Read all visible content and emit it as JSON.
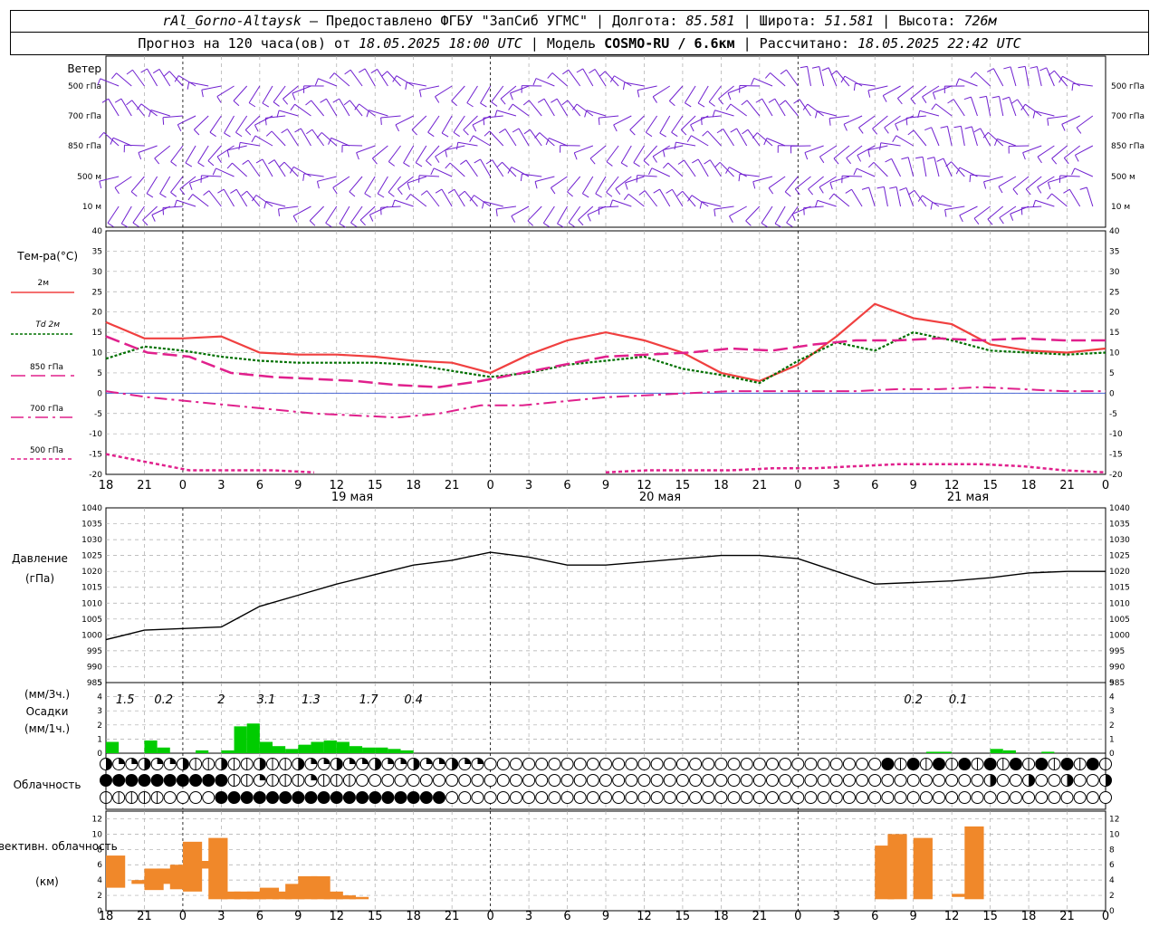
{
  "header": {
    "station": "rAl_Gorno-Altaysk",
    "provider": "— Предоставлено ФГБУ \"ЗапСиб УГМС\"",
    "lon_label": "Долгота:",
    "lon": "85.581",
    "lat_label": "Широта:",
    "lat": "51.581",
    "alt_label": "Высота:",
    "alt": "726м",
    "forecast_prefix": "Прогноз на 120 часа(ов) от",
    "forecast_time": "18.05.2025 18:00 UTC",
    "model_label": "| Модель",
    "model": "COSMO-RU / 6.6км",
    "calc_label": "| Рассчитано:",
    "calc_time": "18.05.2025 22:42 UTC"
  },
  "panels": {
    "wind": {
      "title": "Ветер",
      "levels": [
        "500 гПа",
        "700 гПа",
        "850 гПа",
        "500 м",
        "10 м"
      ]
    },
    "temp": {
      "title": "Тем-ра(°C)",
      "legend": [
        "2м",
        "Td 2м",
        "850 гПа",
        "700 гПа",
        "500 гПа"
      ]
    },
    "pressure": {
      "title": "Давление",
      "unit": "(гПа)"
    },
    "precip": {
      "title": "Осадки",
      "unit_top": "(мм/3ч.)",
      "unit_bottom": "(мм/1ч.)"
    },
    "cloud": {
      "title": "Облачность"
    },
    "conv": {
      "title": "Конвективн. облачность",
      "unit": "(км)"
    }
  },
  "time_axis": {
    "hours": [
      "18",
      "21",
      "0",
      "3",
      "6",
      "9",
      "12",
      "15",
      "18",
      "21",
      "0",
      "3",
      "6",
      "9",
      "12",
      "15",
      "18",
      "21",
      "0",
      "3",
      "6",
      "9",
      "12",
      "15",
      "18",
      "21",
      "0"
    ],
    "days": [
      "19 мая",
      "20 мая",
      "21 мая"
    ]
  },
  "colors": {
    "t2m": "#f04040",
    "td": "#007000",
    "p850": "#e0208c",
    "wind": "#7020d0",
    "precip": "#00cc00",
    "conv": "#f0882a"
  },
  "chart_data": [
    {
      "type": "line",
      "title": "Тем-ра(°C)",
      "x_hours_from_start": [
        0,
        3,
        6,
        9,
        12,
        15,
        18,
        21,
        24,
        27,
        30,
        33,
        36,
        39,
        42,
        45,
        48,
        51,
        54,
        57,
        60,
        63,
        66,
        69,
        72,
        75,
        78
      ],
      "ylim": [
        -20,
        40
      ],
      "series": [
        {
          "name": "2м",
          "values": [
            17.5,
            13.5,
            13.5,
            14,
            10,
            9.5,
            9.5,
            9,
            8,
            7.5,
            5,
            9.5,
            13,
            15,
            13,
            10,
            5,
            3,
            7,
            14,
            22,
            18.5,
            17,
            12,
            10.5,
            10,
            11
          ]
        },
        {
          "name": "Td 2м",
          "values": [
            8.5,
            11.5,
            10.5,
            9,
            8,
            7.5,
            7.5,
            7.5,
            7,
            5.5,
            4,
            5,
            7,
            8,
            9,
            6,
            4.5,
            2.5,
            8,
            12.5,
            10.5,
            15,
            13,
            10.5,
            10,
            9.5,
            10
          ]
        },
        {
          "name": "850 гПа",
          "values": [
            14,
            10,
            9,
            5,
            4,
            3.5,
            3,
            2,
            1.5,
            3,
            5,
            7,
            9,
            9.5,
            10,
            11,
            10.5,
            12,
            13,
            13,
            13.5,
            13,
            13.5,
            13,
            13
          ]
        },
        {
          "name": "700 гПа",
          "values": [
            0.5,
            -1,
            -2,
            -3,
            -4,
            -5,
            -5.5,
            -6,
            -5,
            -3,
            -3,
            -2,
            -1,
            -0.5,
            0,
            0.5,
            0.5,
            0.5,
            0.5,
            1,
            1,
            1.5,
            1,
            0.5,
            0.5
          ]
        },
        {
          "name": "500 гПа",
          "values": [
            -15,
            -17,
            -19,
            -19,
            -19,
            -19.5,
            null,
            null,
            null,
            null,
            null,
            null,
            -19.5,
            -19,
            -19,
            -19,
            -18.5,
            -18.5,
            -18,
            -17.5,
            -17.5,
            -17.5,
            -18,
            -19,
            -19.5
          ]
        }
      ]
    },
    {
      "type": "line",
      "title": "Давление",
      "ylabel": "(гПа)",
      "ylim": [
        985,
        1040
      ],
      "x_hours_from_start": [
        0,
        3,
        6,
        9,
        12,
        15,
        18,
        21,
        24,
        27,
        30,
        33,
        36,
        39,
        42,
        45,
        48,
        51,
        54,
        57,
        60,
        63,
        66,
        69,
        72,
        75,
        78
      ],
      "values": [
        998.5,
        1001.5,
        1002,
        1002.5,
        1009,
        1012.5,
        1016,
        1019,
        1022,
        1023.5,
        1026,
        1024.5,
        1022,
        1022,
        1023,
        1024,
        1025,
        1025,
        1024,
        1020,
        1016,
        1016.5,
        1017,
        1018,
        1019.5,
        1020,
        1020
      ]
    },
    {
      "type": "bar",
      "title": "Осадки",
      "ylim": [
        0,
        5
      ],
      "labels_3h": [
        "1.5",
        "0.2",
        "2",
        "3.1",
        "1.3",
        "1.7",
        "0.4",
        "0.2",
        "0.1"
      ],
      "hourly": [
        0.8,
        0,
        0,
        0.9,
        0.4,
        0,
        0,
        0.2,
        0,
        0.2,
        1.9,
        2.1,
        0.8,
        0.5,
        0.3,
        0.6,
        0.8,
        0.9,
        0.8,
        0.5,
        0.4,
        0.4,
        0.3,
        0.2,
        0,
        0,
        0,
        0,
        0,
        0,
        0,
        0,
        0,
        0,
        0,
        0,
        0,
        0,
        0,
        0,
        0,
        0,
        0,
        0,
        0,
        0,
        0,
        0,
        0,
        0,
        0,
        0,
        0,
        0,
        0,
        0,
        0,
        0,
        0,
        0,
        0,
        0,
        0,
        0,
        0.1,
        0.1,
        0,
        0,
        0,
        0.3,
        0.2,
        0,
        0,
        0.1,
        0,
        0,
        0,
        0,
        0
      ]
    },
    {
      "type": "bar",
      "title": "Конвективн. облачность",
      "ylabel": "(км)",
      "ylim": [
        0,
        13
      ],
      "ranges_km": [
        [
          3,
          7.2
        ],
        [
          3.5,
          4
        ],
        [
          2.7,
          5.5
        ],
        [
          3.5,
          5.5
        ],
        [
          2.8,
          6
        ],
        [
          2.5,
          9
        ],
        [
          5.5,
          6.5
        ],
        [
          1.5,
          9.5
        ],
        [
          1.5,
          2.5
        ],
        [
          1.5,
          2.5
        ],
        [
          1.5,
          2.5
        ],
        [
          1.5,
          3
        ],
        [
          1.5,
          2.5
        ],
        [
          1.5,
          3.5
        ],
        [
          1.5,
          4.5
        ],
        [
          1.5,
          4.5
        ],
        [
          1.5,
          2.5
        ],
        [
          1.5,
          2
        ],
        [
          1.5,
          1.8
        ],
        [
          1.5,
          8.5
        ],
        [
          1.5,
          10
        ],
        [
          1.5,
          9.5
        ],
        [
          1.8,
          2.2
        ],
        [
          1.5,
          11
        ]
      ]
    }
  ]
}
